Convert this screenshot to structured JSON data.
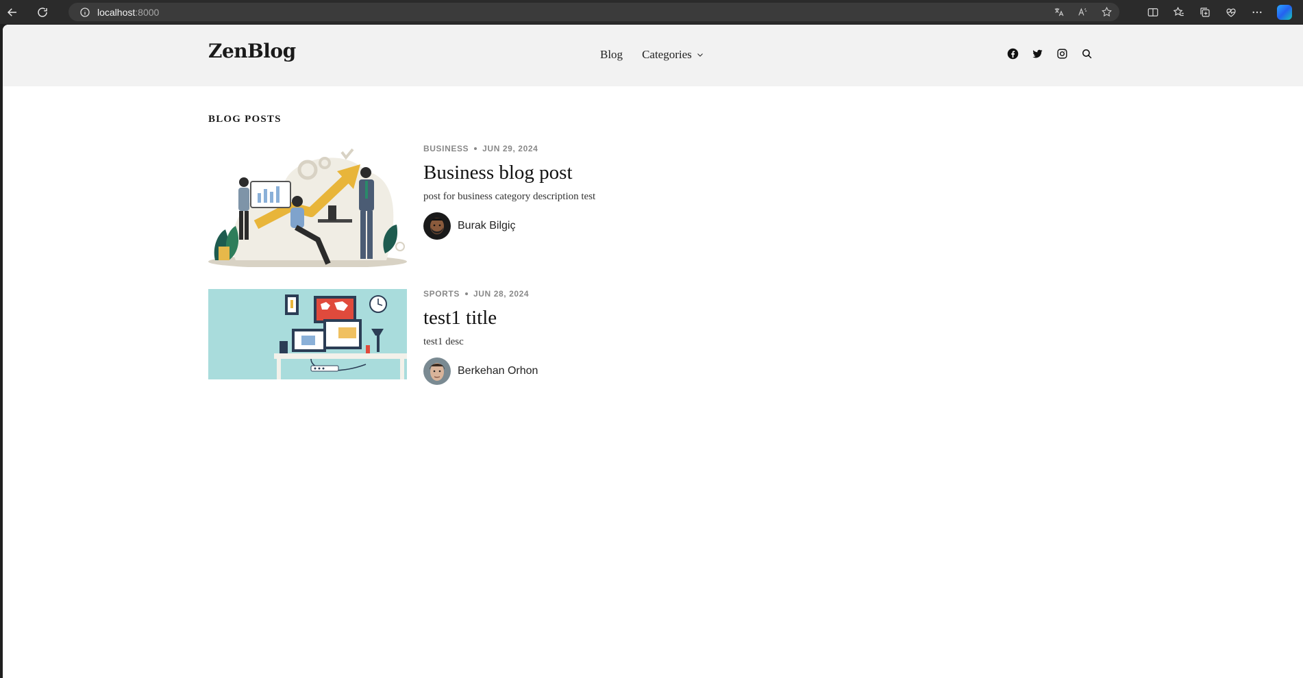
{
  "browser": {
    "url_host": "localhost",
    "url_port": ":8000"
  },
  "site": {
    "logo": "ZenBlog",
    "nav": [
      {
        "label": "Blog"
      },
      {
        "label": "Categories"
      }
    ],
    "social_icons": [
      "facebook-icon",
      "twitter-icon",
      "instagram-icon",
      "search-icon"
    ]
  },
  "section": {
    "title": "BLOG POSTS"
  },
  "posts": [
    {
      "category": "BUSINESS",
      "date": "JUN 29, 2024",
      "title": "Business blog post",
      "description": "post for business category description test",
      "author": "Burak Bilgiç"
    },
    {
      "category": "SPORTS",
      "date": "JUN 28, 2024",
      "title": "test1 title",
      "description": "test1 desc",
      "author": "Berkehan Orhon"
    }
  ],
  "colors": {
    "header_bg": "#f2f2f2",
    "meta_text": "#888888",
    "thumb2_bg": "#a9dcdc"
  }
}
